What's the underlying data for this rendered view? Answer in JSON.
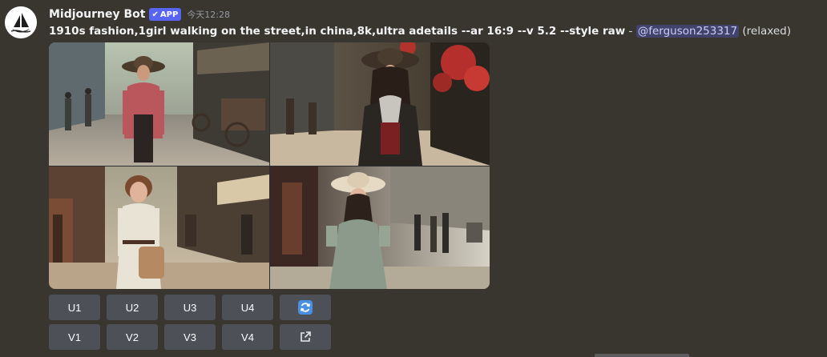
{
  "message": {
    "author": "Midjourney Bot",
    "badge": "APP",
    "badge_icon": "checkmark-icon",
    "timestamp": "今天12:28",
    "prompt": "1910s fashion,1girl walking on the street,in china,8k,ultra adetails --ar 16:9 --v 5.2 --style raw",
    "separator": " - ",
    "mention": "@ferguson253317",
    "status": " (relaxed)"
  },
  "image_grid": {
    "tiles": [
      {
        "description_icon": "image-tile-1"
      },
      {
        "description_icon": "image-tile-2"
      },
      {
        "description_icon": "image-tile-3"
      },
      {
        "description_icon": "image-tile-4"
      }
    ]
  },
  "buttons": {
    "upscale": [
      "U1",
      "U2",
      "U3",
      "U4"
    ],
    "variation": [
      "V1",
      "V2",
      "V3",
      "V4"
    ],
    "reroll_icon": "refresh-icon",
    "web_icon": "external-link-icon"
  },
  "colors": {
    "background": "#393630",
    "button": "#4e5058",
    "badge": "#5865f2",
    "reroll_icon": "#5aa0f0"
  }
}
